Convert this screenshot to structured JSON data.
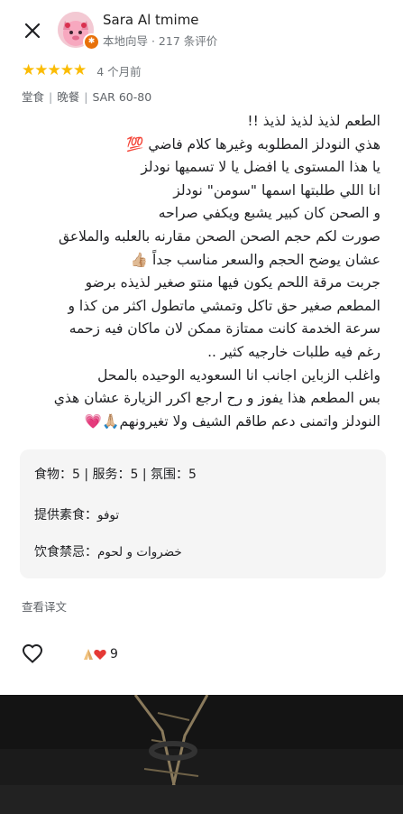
{
  "user": {
    "name": "Sara Al tmime",
    "subtitle": "本地向导 · 217 条评价"
  },
  "rating": {
    "stars": "★★★★★",
    "time": "4 个月前",
    "star_color": "#fbbc04"
  },
  "meta": {
    "service": "堂食",
    "meal": "晚餐",
    "price": "SAR 60-80"
  },
  "review_lines": [
    "الطعم لذيذ لذيذ لذيذ !!",
    "هذي النودلز المطلوبه وغيرها كلام فاضي 💯",
    "يا هذا المستوى يا افضل يا لا تسميها نودلز",
    "انا اللي طلبتها اسمها \"سومن\" نودلز",
    "و الصحن كان كبير يشبع ويكفي صراحه",
    "صورت لكم حجم الصحن الصحن مقارنه بالعلبه والملاعق",
    "عشان يوضح الحجم والسعر مناسب جداً 👍🏼",
    "جربت مرقة اللحم يكون فيها منتو صغير لذيذه برضو",
    "المطعم صغير حق تاكل وتمشي ماتطول اكثر من كذا و",
    "سرعة الخدمة كانت ممتازة ممكن لان ماكان فيه زحمه",
    "رغم فيه طلبات خارجيه كثير ..",
    "واغلب الزباين اجانب انا السعوديه الوحيده بالمحل",
    "بس المطعم هذا يفوز و رح ارجع اكرر الزيارة عشان هذي",
    "النودلز واتمنى دعم طاقم الشيف ولا تغيرونهم🙏🏼💗"
  ],
  "details": {
    "scores": "食物：5 | 服务：5 | 氛围：5",
    "veg_label": "提供素食：",
    "veg_value": "توفو",
    "diet_label": "饮食禁忌：",
    "diet_value": "خضروات و لحوم"
  },
  "translate_label": "查看译文",
  "reactions": {
    "count": "9",
    "icons": [
      "folded-hands-icon",
      "red-heart-icon"
    ]
  },
  "colors": {
    "star": "#fbbc04",
    "badge": "#e8710a",
    "details_bg": "#f5f5f5"
  }
}
